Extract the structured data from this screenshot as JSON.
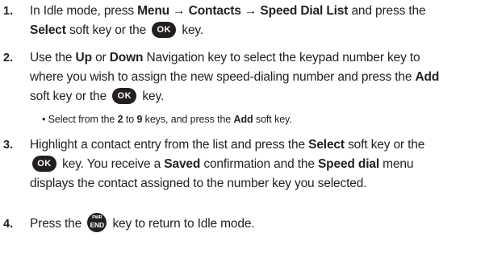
{
  "steps": [
    {
      "number": "1.",
      "lines": [
        [
          "In Idle mode, press ",
          {
            "b": "Menu → Contacts → Speed Dial List"
          },
          " and press the"
        ],
        [
          {
            "b": "Select"
          },
          " soft key or the ",
          {
            "icon": "ok"
          },
          " key."
        ]
      ]
    },
    {
      "number": "2.",
      "lines": [
        [
          "Use the ",
          {
            "b": "Up"
          },
          " or ",
          {
            "b": "Down"
          },
          " Navigation key to select the keypad number key to"
        ],
        [
          "where you wish to assign the new speed-dialing number and press the ",
          {
            "b": "Add"
          }
        ],
        [
          "soft key or the ",
          {
            "icon": "ok"
          },
          " key."
        ]
      ],
      "bullet": [
        "• Select from the ",
        {
          "b": "2"
        },
        " to ",
        {
          "b": "9"
        },
        " keys, and press the ",
        {
          "b": "Add"
        },
        " soft key."
      ]
    },
    {
      "number": "3.",
      "lines": [
        [
          "Highlight a contact entry from the list and press the ",
          {
            "b": "Select"
          },
          " soft key or the"
        ],
        [
          {
            "icon": "ok"
          },
          " key. You receive a ",
          {
            "b": "Saved"
          },
          " confirmation and the ",
          {
            "b": "Speed dial"
          },
          " menu"
        ],
        [
          "displays the contact assigned to the number key you selected."
        ]
      ]
    },
    {
      "number": "4.",
      "lines": [
        [
          "Press the ",
          {
            "icon": "end"
          },
          " key to return to Idle mode."
        ]
      ]
    }
  ],
  "icons": {
    "ok": {
      "name": "ok-key-icon",
      "label": "OK"
    },
    "end": {
      "name": "end-key-icon",
      "top_label": "PWR",
      "label": "END"
    }
  }
}
